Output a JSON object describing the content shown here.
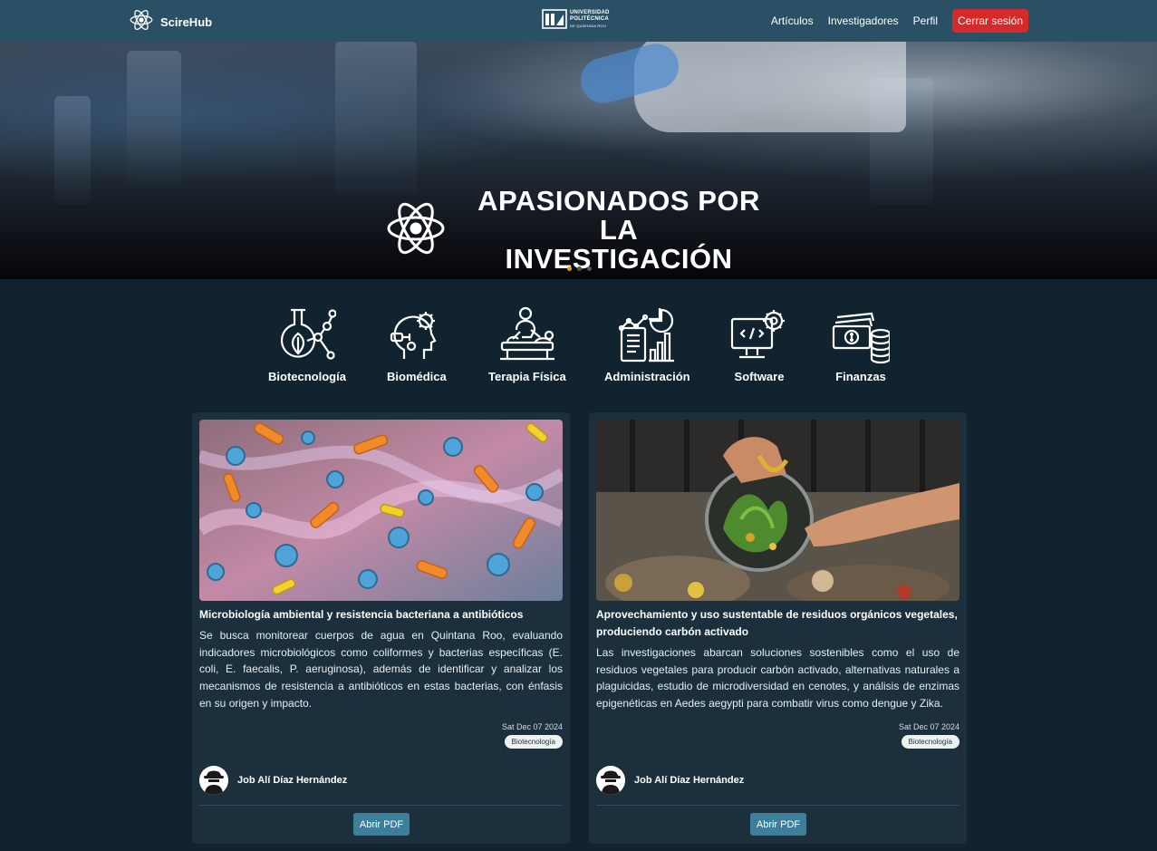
{
  "navbar": {
    "brand": "ScireHub",
    "university": {
      "line1": "UNIVERSIDAD",
      "line2": "POLITÉCNICA",
      "line3": "DE QUINTANA ROO"
    },
    "links": [
      "Artículos",
      "Investigadores",
      "Perfil"
    ],
    "logout_label": "Cerrar sesión",
    "logout_color": "#d52a2a",
    "bar_color": "#2a5066"
  },
  "hero": {
    "title_line1": "APASIONADOS POR LA",
    "title_line2": "INVESTIGACIÓN",
    "slides_count": 3,
    "active_slide": 1,
    "active_dot_color": "#e6a21f"
  },
  "categories": [
    {
      "label": "Biotecnología",
      "icon": "biotech-flask-icon"
    },
    {
      "label": "Biomédica",
      "icon": "biomedical-head-gear-icon"
    },
    {
      "label": "Terapia Física",
      "icon": "physical-therapy-icon"
    },
    {
      "label": "Administración",
      "icon": "administration-chart-icon"
    },
    {
      "label": "Software",
      "icon": "software-monitor-gear-icon"
    },
    {
      "label": "Finanzas",
      "icon": "finance-money-icon"
    }
  ],
  "articles": [
    {
      "title": "Microbiología ambiental y resistencia bacteriana a antibióticos",
      "description": "Se busca monitorear cuerpos de agua en Quintana Roo, evaluando indicadores microbiológicos como coliformes y bacterias específicas (E. coli, E. faecalis, P. aeruginosa), además de identificar y analizar los mecanismos de resistencia a antibióticos en estas bacterias, con énfasis en su origen y impacto.",
      "date": "Sat Dec 07 2024",
      "tag": "Biotecnología",
      "author": "Job Alí Díaz Hernández",
      "button": "Abrir PDF"
    },
    {
      "title": "Aprovechamiento y uso sustentable de residuos orgánicos vegetales, produciendo carbón activado",
      "description": "Las investigaciones abarcan soluciones sostenibles como el uso de residuos vegetales para producir carbón activado, alternativas naturales a plaguicidas, estudio de microdiversidad en cenotes, y análisis de enzimas epigenéticas en Aedes aegypti para combatir virus como dengue y Zika.",
      "date": "Sat Dec 07 2024",
      "tag": "Biotecnología",
      "author": "Job Alí Díaz Hernández",
      "button": "Abrir PDF"
    }
  ]
}
